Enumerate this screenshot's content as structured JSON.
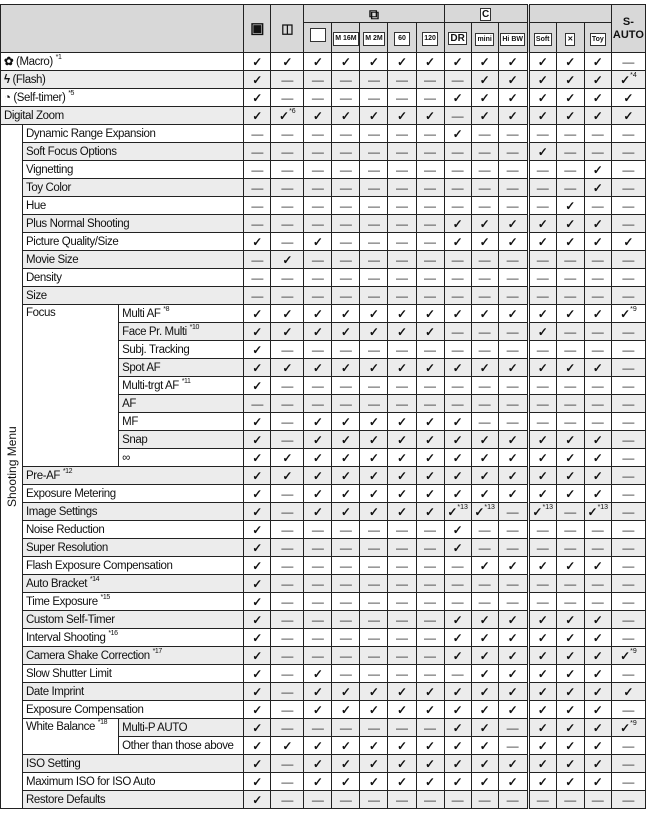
{
  "header": {
    "camera_icon": "camera-icon",
    "movie_icon": "movie-icon",
    "continuous_group_icon": "continuous-icon",
    "continuous": [
      "",
      "M 16M",
      "M 2M",
      "60",
      "120"
    ],
    "scene_group_icon": "scene-c-icon",
    "scene": [
      "DR",
      "mini",
      "Hi BW"
    ],
    "effects": [
      "Soft",
      "✕",
      "Toy"
    ],
    "sauto": "S-AUTO"
  },
  "section_label": "Shooting Menu",
  "top_rows": [
    {
      "icon": "✿",
      "label": "(Macro)",
      "note": "*1",
      "values": [
        "✓",
        "✓",
        "✓",
        "✓",
        "✓",
        "✓",
        "✓",
        "✓",
        "✓",
        "✓",
        "✓",
        "✓",
        "✓",
        "—"
      ]
    },
    {
      "icon": "ϟ",
      "label": "(Flash)",
      "note": "",
      "values": [
        "✓",
        "—",
        "—",
        "—",
        "—",
        "—",
        "—",
        "—",
        "✓",
        "✓",
        "✓",
        "✓",
        "✓",
        "✓*4"
      ]
    },
    {
      "icon": "◔",
      "label": "(Self-timer)",
      "note": "*5",
      "values": [
        "✓",
        "—",
        "—",
        "—",
        "—",
        "—",
        "—",
        "✓",
        "✓",
        "✓",
        "✓",
        "✓",
        "✓",
        "✓"
      ]
    },
    {
      "icon": "",
      "label": "Digital Zoom",
      "note": "",
      "values": [
        "✓",
        "✓*6",
        "✓",
        "✓",
        "✓",
        "✓",
        "✓",
        "—",
        "✓",
        "✓",
        "✓",
        "✓",
        "✓",
        "✓"
      ]
    }
  ],
  "menu_rows": [
    {
      "label": "Dynamic Range Expansion",
      "values": [
        "—",
        "—",
        "—",
        "—",
        "—",
        "—",
        "—",
        "✓",
        "—",
        "—",
        "—",
        "—",
        "—",
        "—"
      ]
    },
    {
      "label": "Soft Focus Options",
      "values": [
        "—",
        "—",
        "—",
        "—",
        "—",
        "—",
        "—",
        "—",
        "—",
        "—",
        "✓",
        "—",
        "—",
        "—"
      ]
    },
    {
      "label": "Vignetting",
      "values": [
        "—",
        "—",
        "—",
        "—",
        "—",
        "—",
        "—",
        "—",
        "—",
        "—",
        "—",
        "—",
        "✓",
        "—"
      ]
    },
    {
      "label": "Toy Color",
      "values": [
        "—",
        "—",
        "—",
        "—",
        "—",
        "—",
        "—",
        "—",
        "—",
        "—",
        "—",
        "—",
        "✓",
        "—"
      ]
    },
    {
      "label": "Hue",
      "values": [
        "—",
        "—",
        "—",
        "—",
        "—",
        "—",
        "—",
        "—",
        "—",
        "—",
        "—",
        "✓",
        "—",
        "—"
      ]
    },
    {
      "label": "Plus Normal Shooting",
      "values": [
        "—",
        "—",
        "—",
        "—",
        "—",
        "—",
        "—",
        "✓",
        "✓",
        "✓",
        "✓",
        "✓",
        "✓",
        "—"
      ]
    },
    {
      "label": "Picture Quality/Size",
      "values": [
        "✓",
        "—",
        "✓",
        "—",
        "—",
        "—",
        "—",
        "✓",
        "✓",
        "✓",
        "✓",
        "✓",
        "✓",
        "✓"
      ]
    },
    {
      "label": "Movie Size",
      "values": [
        "—",
        "✓",
        "—",
        "—",
        "—",
        "—",
        "—",
        "—",
        "—",
        "—",
        "—",
        "—",
        "—",
        "—"
      ]
    },
    {
      "label": "Density",
      "values": [
        "—",
        "—",
        "—",
        "—",
        "—",
        "—",
        "—",
        "—",
        "—",
        "—",
        "—",
        "—",
        "—",
        "—"
      ]
    },
    {
      "label": "Size",
      "values": [
        "—",
        "—",
        "—",
        "—",
        "—",
        "—",
        "—",
        "—",
        "—",
        "—",
        "—",
        "—",
        "—",
        "—"
      ]
    },
    {
      "label": "Focus",
      "subs": [
        {
          "label": "Multi AF",
          "note": "*8",
          "values": [
            "✓",
            "✓",
            "✓",
            "✓",
            "✓",
            "✓",
            "✓",
            "✓",
            "✓",
            "✓",
            "✓",
            "✓",
            "✓",
            "✓*9"
          ]
        },
        {
          "label": "Face Pr. Multi",
          "note": "*10",
          "values": [
            "✓",
            "✓",
            "✓",
            "✓",
            "✓",
            "✓",
            "✓",
            "—",
            "—",
            "—",
            "✓",
            "—",
            "—",
            "—"
          ]
        },
        {
          "label": "Subj. Tracking",
          "values": [
            "✓",
            "—",
            "—",
            "—",
            "—",
            "—",
            "—",
            "—",
            "—",
            "—",
            "—",
            "—",
            "—",
            "—"
          ]
        },
        {
          "label": "Spot AF",
          "values": [
            "✓",
            "✓",
            "✓",
            "✓",
            "✓",
            "✓",
            "✓",
            "✓",
            "✓",
            "✓",
            "✓",
            "✓",
            "✓",
            "—"
          ]
        },
        {
          "label": "Multi-trgt AF",
          "note": "*11",
          "values": [
            "✓",
            "—",
            "—",
            "—",
            "—",
            "—",
            "—",
            "—",
            "—",
            "—",
            "—",
            "—",
            "—",
            "—"
          ]
        },
        {
          "label": "AF",
          "values": [
            "—",
            "—",
            "—",
            "—",
            "—",
            "—",
            "—",
            "—",
            "—",
            "—",
            "—",
            "—",
            "—",
            "—"
          ]
        },
        {
          "label": "MF",
          "values": [
            "✓",
            "—",
            "✓",
            "✓",
            "✓",
            "✓",
            "✓",
            "✓",
            "—",
            "—",
            "—",
            "—",
            "—",
            "—"
          ]
        },
        {
          "label": "Snap",
          "values": [
            "✓",
            "—",
            "✓",
            "✓",
            "✓",
            "✓",
            "✓",
            "✓",
            "✓",
            "✓",
            "✓",
            "✓",
            "✓",
            "—"
          ]
        },
        {
          "label": "∞",
          "values": [
            "✓",
            "✓",
            "✓",
            "✓",
            "✓",
            "✓",
            "✓",
            "✓",
            "✓",
            "✓",
            "✓",
            "✓",
            "✓",
            "—"
          ]
        }
      ]
    },
    {
      "label": "Pre-AF",
      "note": "*12",
      "values": [
        "✓",
        "✓",
        "✓",
        "✓",
        "✓",
        "✓",
        "✓",
        "✓",
        "✓",
        "✓",
        "✓",
        "✓",
        "✓",
        "—"
      ]
    },
    {
      "label": "Exposure Metering",
      "values": [
        "✓",
        "—",
        "✓",
        "✓",
        "✓",
        "✓",
        "✓",
        "✓",
        "✓",
        "✓",
        "✓",
        "✓",
        "✓",
        "—"
      ]
    },
    {
      "label": "Image Settings",
      "values": [
        "✓",
        "—",
        "✓",
        "✓",
        "✓",
        "✓",
        "✓",
        "✓*13",
        "✓*13",
        "—",
        "✓*13",
        "—",
        "✓*13",
        "—"
      ]
    },
    {
      "label": "Noise Reduction",
      "values": [
        "✓",
        "—",
        "—",
        "—",
        "—",
        "—",
        "—",
        "✓",
        "—",
        "—",
        "—",
        "—",
        "—",
        "—"
      ]
    },
    {
      "label": "Super Resolution",
      "values": [
        "✓",
        "—",
        "—",
        "—",
        "—",
        "—",
        "—",
        "✓",
        "—",
        "—",
        "—",
        "—",
        "—",
        "—"
      ]
    },
    {
      "label": "Flash Exposure Compensation",
      "values": [
        "✓",
        "—",
        "—",
        "—",
        "—",
        "—",
        "—",
        "—",
        "✓",
        "✓",
        "✓",
        "✓",
        "✓",
        "—"
      ]
    },
    {
      "label": "Auto Bracket",
      "note": "*14",
      "values": [
        "✓",
        "—",
        "—",
        "—",
        "—",
        "—",
        "—",
        "—",
        "—",
        "—",
        "—",
        "—",
        "—",
        "—"
      ]
    },
    {
      "label": "Time Exposure",
      "note": "*15",
      "values": [
        "✓",
        "—",
        "—",
        "—",
        "—",
        "—",
        "—",
        "—",
        "—",
        "—",
        "—",
        "—",
        "—",
        "—"
      ]
    },
    {
      "label": "Custom Self-Timer",
      "values": [
        "✓",
        "—",
        "—",
        "—",
        "—",
        "—",
        "—",
        "✓",
        "✓",
        "✓",
        "✓",
        "✓",
        "✓",
        "—"
      ]
    },
    {
      "label": "Interval Shooting",
      "note": "*16",
      "values": [
        "✓",
        "—",
        "—",
        "—",
        "—",
        "—",
        "—",
        "✓",
        "✓",
        "✓",
        "✓",
        "✓",
        "✓",
        "—"
      ]
    },
    {
      "label": "Camera Shake Correction",
      "note": "*17",
      "values": [
        "✓",
        "—",
        "—",
        "—",
        "—",
        "—",
        "—",
        "✓",
        "✓",
        "✓",
        "✓",
        "✓",
        "✓",
        "✓*9"
      ]
    },
    {
      "label": "Slow Shutter Limit",
      "values": [
        "✓",
        "—",
        "✓",
        "—",
        "—",
        "—",
        "—",
        "—",
        "✓",
        "✓",
        "✓",
        "✓",
        "✓",
        "—"
      ]
    },
    {
      "label": "Date Imprint",
      "values": [
        "✓",
        "—",
        "✓",
        "✓",
        "✓",
        "✓",
        "✓",
        "✓",
        "✓",
        "✓",
        "✓",
        "✓",
        "✓",
        "✓"
      ]
    },
    {
      "label": "Exposure Compensation",
      "values": [
        "✓",
        "—",
        "✓",
        "✓",
        "✓",
        "✓",
        "✓",
        "✓",
        "✓",
        "✓",
        "✓",
        "✓",
        "✓",
        "—"
      ]
    },
    {
      "label": "White Balance",
      "note": "*18",
      "subs": [
        {
          "label": "Multi-P AUTO",
          "values": [
            "✓",
            "—",
            "—",
            "—",
            "—",
            "—",
            "—",
            "✓",
            "✓",
            "—",
            "✓",
            "✓",
            "✓",
            "✓*9"
          ]
        },
        {
          "label": "Other than those above",
          "values": [
            "✓",
            "✓",
            "✓",
            "✓",
            "✓",
            "✓",
            "✓",
            "✓",
            "✓",
            "—",
            "✓",
            "✓",
            "✓",
            "—"
          ]
        }
      ]
    },
    {
      "label": "ISO Setting",
      "values": [
        "✓",
        "—",
        "✓",
        "✓",
        "✓",
        "✓",
        "✓",
        "✓",
        "✓",
        "✓",
        "✓",
        "✓",
        "✓",
        "—"
      ]
    },
    {
      "label": "Maximum ISO for ISO Auto",
      "values": [
        "✓",
        "—",
        "✓",
        "✓",
        "✓",
        "✓",
        "✓",
        "✓",
        "✓",
        "✓",
        "✓",
        "✓",
        "✓",
        "—"
      ]
    },
    {
      "label": "Restore Defaults",
      "values": [
        "✓",
        "—",
        "—",
        "—",
        "—",
        "—",
        "—",
        "—",
        "—",
        "—",
        "—",
        "—",
        "—",
        "—"
      ]
    }
  ]
}
